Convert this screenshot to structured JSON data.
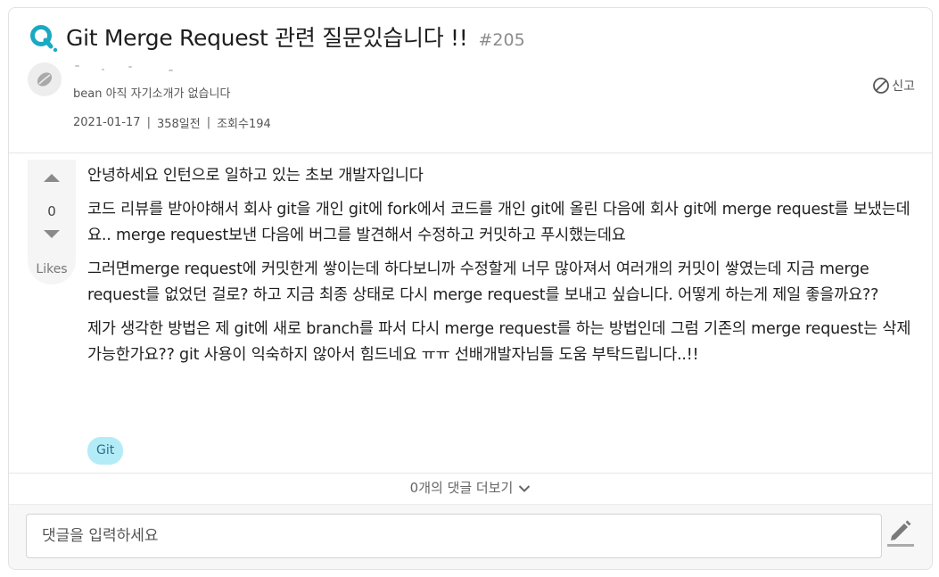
{
  "question": {
    "title": "Git Merge Request 관련 질문있습니다 !!",
    "number": "#205"
  },
  "author": {
    "intro": "bean 아직 자기소개가 없습니다"
  },
  "report_label": "신고",
  "meta": {
    "date": "2021-01-17",
    "relative": "358일전",
    "views": "조회수194"
  },
  "vote": {
    "count": "0",
    "label": "Likes"
  },
  "body": {
    "paragraphs": [
      "안녕하세요 인턴으로 일하고 있는 초보 개발자입니다",
      "코드 리뷰를 받아야해서 회사 git을 개인 git에 fork에서 코드를 개인 git에 올린 다음에 회사 git에 merge request를 보냈는데요.. merge request보낸 다음에 버그를 발견해서 수정하고 커밋하고 푸시했는데요",
      "그러면merge request에 커밋한게 쌓이는데 하다보니까 수정할게 너무 많아져서 여러개의 커밋이 쌓였는데 지금 merge request를 없었던 걸로? 하고 지금 최종 상태로 다시 merge request를 보내고 싶습니다. 어떻게 하는게 제일 좋을까요??",
      "제가 생각한 방법은 제 git에 새로 branch를 파서 다시 merge request를 하는 방법인데 그럼 기존의 merge request는 삭제 가능한가요?? git 사용이 익숙하지 않아서 힘드네요 ㅠㅠ 선배개발자님들 도움 부탁드립니다..!!"
    ]
  },
  "tag": "Git",
  "comments": {
    "more_label": "0개의 댓글 더보기",
    "input_placeholder": "댓글을 입력하세요"
  },
  "colors": {
    "brand": "#1aa9c2",
    "tag_bg": "#b3ecf7",
    "tag_text": "#2b6f86"
  },
  "icons": [
    "q-icon",
    "coffee-bean-icon",
    "ban-icon",
    "arrow-up-icon",
    "arrow-down-icon",
    "chevron-down-icon",
    "pencil-icon"
  ]
}
